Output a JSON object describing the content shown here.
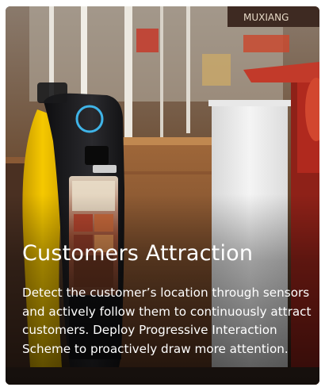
{
  "card": {
    "title": "Customers Attraction",
    "description": "Detect the customer’s location through sensors and actively follow them to continuously attract customers. Deploy Progressive Interaction Scheme to proactively draw more attention.",
    "sign_text": "MUXIANG",
    "robot_badge_text": "✕ ✕"
  },
  "colors": {
    "robot_accent": "#f2c200",
    "robot_body": "#1e1e20",
    "ring_light": "#3fb4e8",
    "counter": "#f1f1f1",
    "stand_red": "#b0291e",
    "wood": "#7a4a26"
  }
}
